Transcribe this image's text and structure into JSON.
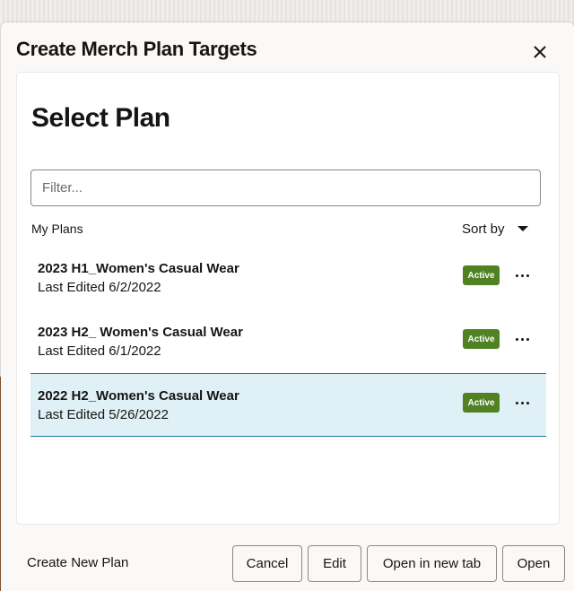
{
  "dialog": {
    "title": "Create Merch Plan Targets",
    "close_icon": "close-icon"
  },
  "content": {
    "section_title": "Select Plan",
    "filter": {
      "placeholder": "Filter...",
      "value": ""
    },
    "list_label": "My Plans",
    "sort_label": "Sort by",
    "sort_icon": "caret-down-icon"
  },
  "plans": [
    {
      "name": "2023 H1_Women's Casual Wear",
      "meta": "Last Edited 6/2/2022",
      "status": "Active",
      "selected": false
    },
    {
      "name": "2023 H2_ Women's Casual Wear",
      "meta": "Last Edited 6/1/2022",
      "status": "Active",
      "selected": false
    },
    {
      "name": "2022 H2_Women's Casual Wear",
      "meta": "Last Edited 5/26/2022",
      "status": "Active",
      "selected": true
    }
  ],
  "colors": {
    "active_badge": "#508223",
    "selected_row_bg": "#dff0f6",
    "selected_row_border": "#1a7ba0"
  },
  "footer": {
    "create_new_label": "Create New Plan",
    "cancel_label": "Cancel",
    "edit_label": "Edit",
    "open_new_tab_label": "Open in new tab",
    "open_label": "Open"
  }
}
